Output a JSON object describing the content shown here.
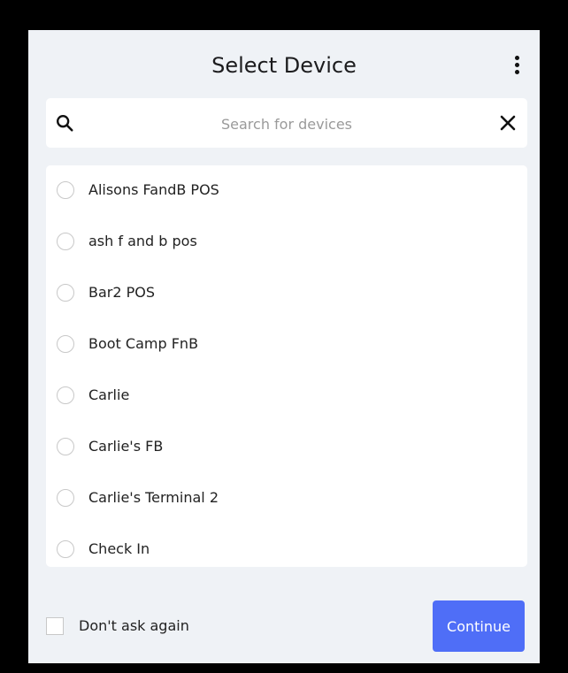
{
  "header": {
    "title": "Select Device",
    "menu_icon": "more-vert-icon"
  },
  "search": {
    "placeholder": "Search for devices",
    "value": "",
    "icon": "search-icon",
    "clear_icon": "close-icon"
  },
  "devices": [
    {
      "label": "Alisons FandB POS",
      "selected": false
    },
    {
      "label": "ash f and b pos",
      "selected": false
    },
    {
      "label": "Bar2 POS",
      "selected": false
    },
    {
      "label": "Boot Camp FnB",
      "selected": false
    },
    {
      "label": "Carlie",
      "selected": false
    },
    {
      "label": "Carlie's FB",
      "selected": false
    },
    {
      "label": "Carlie's Terminal 2",
      "selected": false
    },
    {
      "label": "Check In",
      "selected": false
    }
  ],
  "footer": {
    "dont_ask_label": "Don't ask again",
    "dont_ask_checked": false,
    "continue_label": "Continue"
  },
  "colors": {
    "accent": "#4f6ef7",
    "background": "#eff2f6",
    "surface": "#ffffff"
  }
}
